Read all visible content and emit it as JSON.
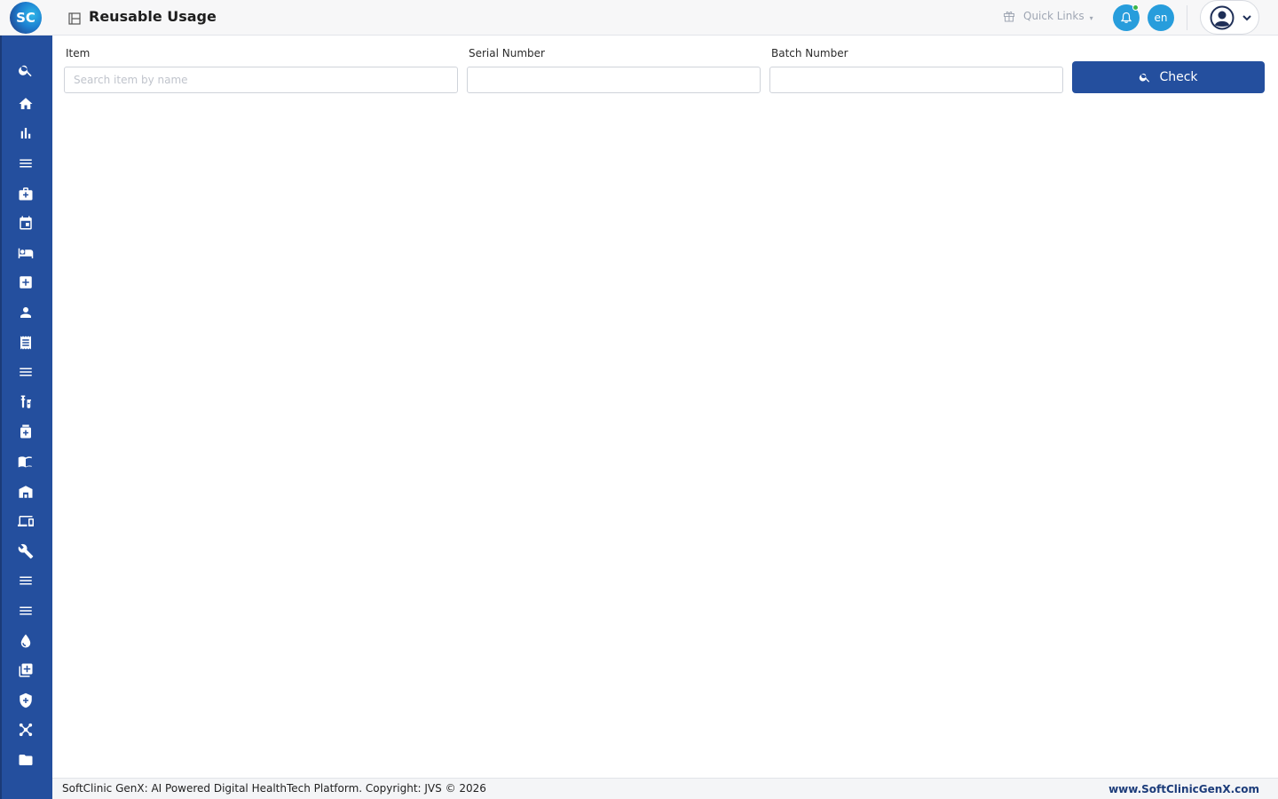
{
  "header": {
    "logo_text": "SC",
    "page_icon": "page-icon",
    "title": "Reusable Usage",
    "quick_links_label": "Quick Links",
    "language": "en",
    "accent_color": "#279ddc",
    "notification_status_color": "#3cb54a"
  },
  "sidebar": {
    "background": "#244f9e",
    "items": [
      {
        "name": "search-icon"
      },
      {
        "name": "home-icon"
      },
      {
        "name": "bar-chart-icon"
      },
      {
        "name": "menu-icon"
      },
      {
        "name": "medical-bag-icon"
      },
      {
        "name": "calendar-icon"
      },
      {
        "name": "bed-icon"
      },
      {
        "name": "medical-plus-icon"
      },
      {
        "name": "person-icon"
      },
      {
        "name": "receipt-icon"
      },
      {
        "name": "menu-icon"
      },
      {
        "name": "lab-icon"
      },
      {
        "name": "pharmacy-icon"
      },
      {
        "name": "book-icon"
      },
      {
        "name": "warehouse-icon"
      },
      {
        "name": "devices-icon"
      },
      {
        "name": "wrench-icon"
      },
      {
        "name": "menu-icon"
      },
      {
        "name": "menu-icon"
      },
      {
        "name": "blood-drop-icon"
      },
      {
        "name": "add-library-icon"
      },
      {
        "name": "shield-plus-icon"
      },
      {
        "name": "hub-icon"
      },
      {
        "name": "folder-icon"
      }
    ]
  },
  "form": {
    "item": {
      "label": "Item",
      "placeholder": "Search item by name",
      "value": ""
    },
    "serial": {
      "label": "Serial Number",
      "placeholder": "",
      "value": ""
    },
    "batch": {
      "label": "Batch Number",
      "placeholder": "",
      "value": ""
    },
    "check_label": "Check",
    "button_color": "#244f9e"
  },
  "footer": {
    "copyright": "SoftClinic GenX: AI Powered Digital HealthTech Platform. Copyright: JVS © 2026",
    "website": "www.SoftClinicGenX.com"
  }
}
